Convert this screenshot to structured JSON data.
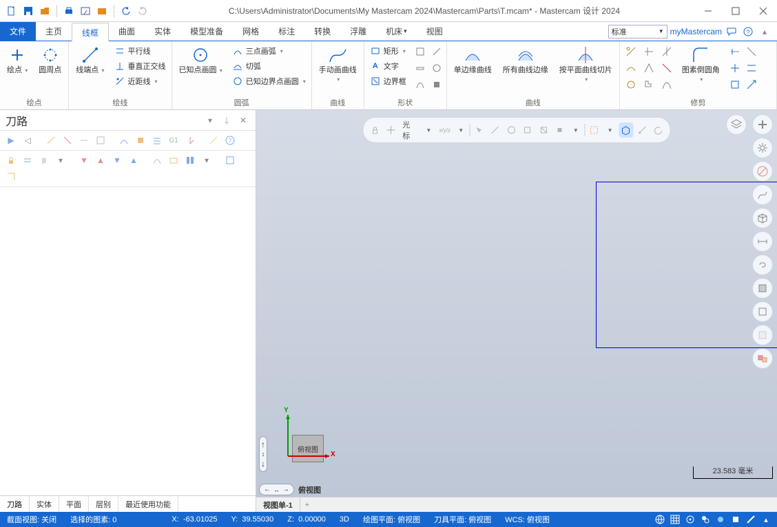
{
  "title": "C:\\Users\\Administrator\\Documents\\My Mastercam 2024\\Mastercam\\Parts\\T.mcam* - Mastercam 设计 2024",
  "tabs": {
    "file": "文件",
    "items": [
      "主页",
      "线框",
      "曲面",
      "实体",
      "模型准备",
      "网格",
      "标注",
      "转换",
      "浮雕",
      "机床",
      "视图"
    ],
    "active_index": 1
  },
  "ribbon_right": {
    "combo": "标准",
    "my": "myMastercam"
  },
  "ribbon": {
    "g1": {
      "b1": "绘点",
      "b2": "圆周点",
      "title": "绘点"
    },
    "g2": {
      "b1": "线端点",
      "rows": [
        "平行线",
        "垂直正交线",
        "近距线"
      ],
      "title": "绘线"
    },
    "g3": {
      "b1": "已知点画圆",
      "rows": [
        "三点画弧",
        "切弧",
        "已知边界点画圆"
      ],
      "title": "圆弧"
    },
    "g4": {
      "b1": "手动画曲线",
      "title": "曲线"
    },
    "g5": {
      "rows": [
        "矩形",
        "文字",
        "边界框"
      ],
      "title": "形状"
    },
    "g6": {
      "b1": "单边缘曲线",
      "b2": "所有曲线边缘",
      "b3": "按平面曲线切片",
      "title": "曲线"
    },
    "g7": {
      "b1": "图素倒圆角",
      "title": "修剪"
    }
  },
  "panel": {
    "title": "刀路",
    "tabs": [
      "刀路",
      "实体",
      "平面",
      "层别",
      "最近使用功能"
    ],
    "active_tab": 0
  },
  "selection_toolbar": {
    "label": "光标"
  },
  "viewport": {
    "gnomon_x": "X",
    "gnomon_y": "Y",
    "view_label": "俯视图",
    "scale": "23.583 毫米",
    "nav_label": "俯视图",
    "tab": "视图单-1"
  },
  "status": {
    "s1": "截面视图: 关闭",
    "s2": "选择的图素: 0",
    "x": "X:",
    "xv": "-63.01025",
    "y": "Y:",
    "yv": "39.55030",
    "z": "Z:",
    "zv": "0.00000",
    "s3": "3D",
    "s4": "绘图平面: 俯视图",
    "s5": "刀具平面: 俯视图",
    "s6": "WCS: 俯视图"
  }
}
